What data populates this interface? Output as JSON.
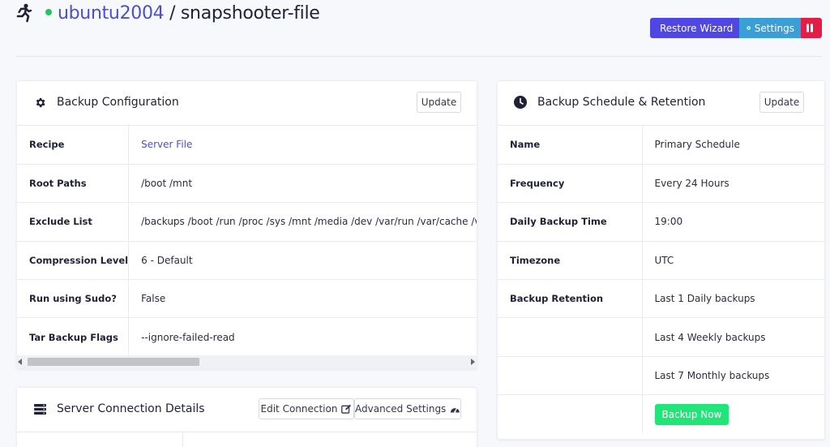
{
  "header": {
    "icon": "running-person-icon",
    "server": "ubuntu2004",
    "separator": "/",
    "job": "snapshooter-file",
    "status_color": "#22c55e",
    "buttons": {
      "restore_wizard": "Restore Wizard",
      "settings": "Settings",
      "pause_icon": "pause-icon"
    }
  },
  "backup_config": {
    "title": "Backup Configuration",
    "icon": "gear-icon",
    "update_label": "Update",
    "rows": [
      {
        "key": "Recipe",
        "value": "Server File"
      },
      {
        "key": "Root Paths",
        "value": "/boot /mnt"
      },
      {
        "key": "Exclude List",
        "value": "/backups /boot /run /proc /sys /mnt /media /dev /var/run /var/cache /var/tmp"
      },
      {
        "key": "Compression Level",
        "value": "6 - Default"
      },
      {
        "key": "Run using Sudo?",
        "value": "False"
      },
      {
        "key": "Tar Backup Flags",
        "value": "--ignore-failed-read"
      }
    ]
  },
  "server_connection": {
    "title": "Server Connection Details",
    "icon": "server-icon",
    "edit_label": "Edit Connection",
    "edit_icon": "edit-icon",
    "advanced_label": "Advanced Settings",
    "advanced_icon": "gauge-icon"
  },
  "schedule": {
    "title": "Backup Schedule & Retention",
    "icon": "clock-icon",
    "update_label": "Update",
    "rows": [
      {
        "key": "Name",
        "value": "Primary Schedule"
      },
      {
        "key": "Frequency",
        "value": "Every 24 Hours"
      },
      {
        "key": "Daily Backup Time",
        "value": "19:00"
      },
      {
        "key": "Timezone",
        "value": "UTC"
      },
      {
        "key": "Backup Retention",
        "value": "Last 1 Daily backups"
      },
      {
        "key": "",
        "value": "Last 4 Weekly backups"
      },
      {
        "key": "",
        "value": "Last 7 Monthly backups"
      }
    ],
    "backup_now_label": "Backup Now"
  }
}
